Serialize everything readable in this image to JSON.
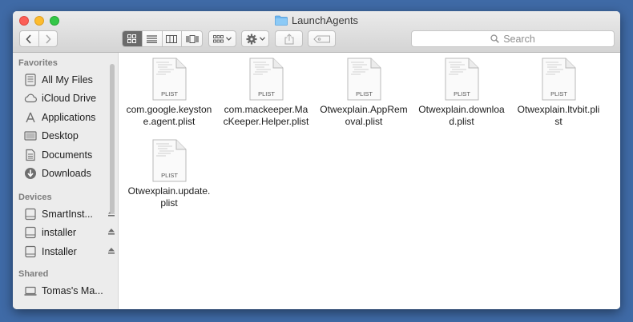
{
  "window": {
    "title": "LaunchAgents",
    "folder_icon": "folder-icon"
  },
  "toolbar": {
    "back_icon": "chevron-left-icon",
    "forward_icon": "chevron-right-icon",
    "view_modes": [
      "icon-view",
      "list-view",
      "column-view",
      "cover-flow-view"
    ],
    "arrange_icon": "arrange-grid-icon",
    "action_icon": "gear-icon",
    "share_icon": "share-icon",
    "tags_icon": "tag-icon",
    "search_placeholder": "Search"
  },
  "sidebar": {
    "favorites_header": "Favorites",
    "favorites": [
      {
        "label": "All My Files",
        "icon": "all-files-icon"
      },
      {
        "label": "iCloud Drive",
        "icon": "cloud-icon"
      },
      {
        "label": "Applications",
        "icon": "applications-icon"
      },
      {
        "label": "Desktop",
        "icon": "desktop-icon"
      },
      {
        "label": "Documents",
        "icon": "documents-icon"
      },
      {
        "label": "Downloads",
        "icon": "downloads-icon"
      }
    ],
    "devices_header": "Devices",
    "devices": [
      {
        "label": "SmartInst...",
        "icon": "disk-icon",
        "eject": true
      },
      {
        "label": "installer",
        "icon": "disk-icon",
        "eject": true
      },
      {
        "label": "Installer",
        "icon": "disk-icon",
        "eject": true
      }
    ],
    "shared_header": "Shared",
    "shared": [
      {
        "label": "Tomas's Ma...",
        "icon": "computer-icon"
      }
    ]
  },
  "files": [
    {
      "line1": "com.google.keyston",
      "line2": "e.agent.plist",
      "badge": "PLIST"
    },
    {
      "line1": "com.mackeeper.Ma",
      "line2": "cKeeper.Helper.plist",
      "badge": "PLIST"
    },
    {
      "line1": "Otwexplain.AppRem",
      "line2": "oval.plist",
      "badge": "PLIST"
    },
    {
      "line1": "Otwexplain.downloa",
      "line2": "d.plist",
      "badge": "PLIST"
    },
    {
      "line1": "Otwexplain.ltvbit.pli",
      "line2": "st",
      "badge": "PLIST"
    },
    {
      "line1": "Otwexplain.update.",
      "line2": "plist",
      "badge": "PLIST"
    }
  ]
}
